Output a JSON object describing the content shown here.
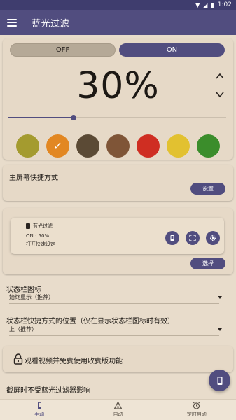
{
  "status_bar": {
    "time": "1:02"
  },
  "app_bar": {
    "title": "蓝光过滤"
  },
  "filter": {
    "off_label": "OFF",
    "on_label": "ON",
    "state": "on",
    "percent_text": "30%",
    "intensity": 0.3
  },
  "colors": {
    "accent": "#514d7f",
    "swatches": [
      "#a49b2f",
      "#e28722",
      "#5b4a35",
      "#7f5537",
      "#cf2e22",
      "#e2c130",
      "#3b8d2b"
    ],
    "selected_index": 1
  },
  "shortcut": {
    "label": "主屏幕快捷方式",
    "button": "设置"
  },
  "tile": {
    "app_name": "蓝光过滤",
    "status": "ON : 50%",
    "action": "打开快速设定",
    "select_button": "选择"
  },
  "status_icon": {
    "title": "状态栏图标",
    "value": "始终显示（推荐）"
  },
  "status_position": {
    "title": "状态栏快捷方式的位置（仅在显示状态栏图标时有效）",
    "value": "上（推荐）"
  },
  "premium": {
    "text": "观看视频并免费使用收费版功能"
  },
  "screenshot": {
    "text": "截屏时不受蓝光过滤器影响"
  },
  "nav": {
    "items": [
      {
        "label": "手动",
        "icon": "manual-icon"
      },
      {
        "label": "自动",
        "icon": "auto-icon"
      },
      {
        "label": "定时启动",
        "icon": "alarm-icon"
      }
    ],
    "active_index": 0
  }
}
